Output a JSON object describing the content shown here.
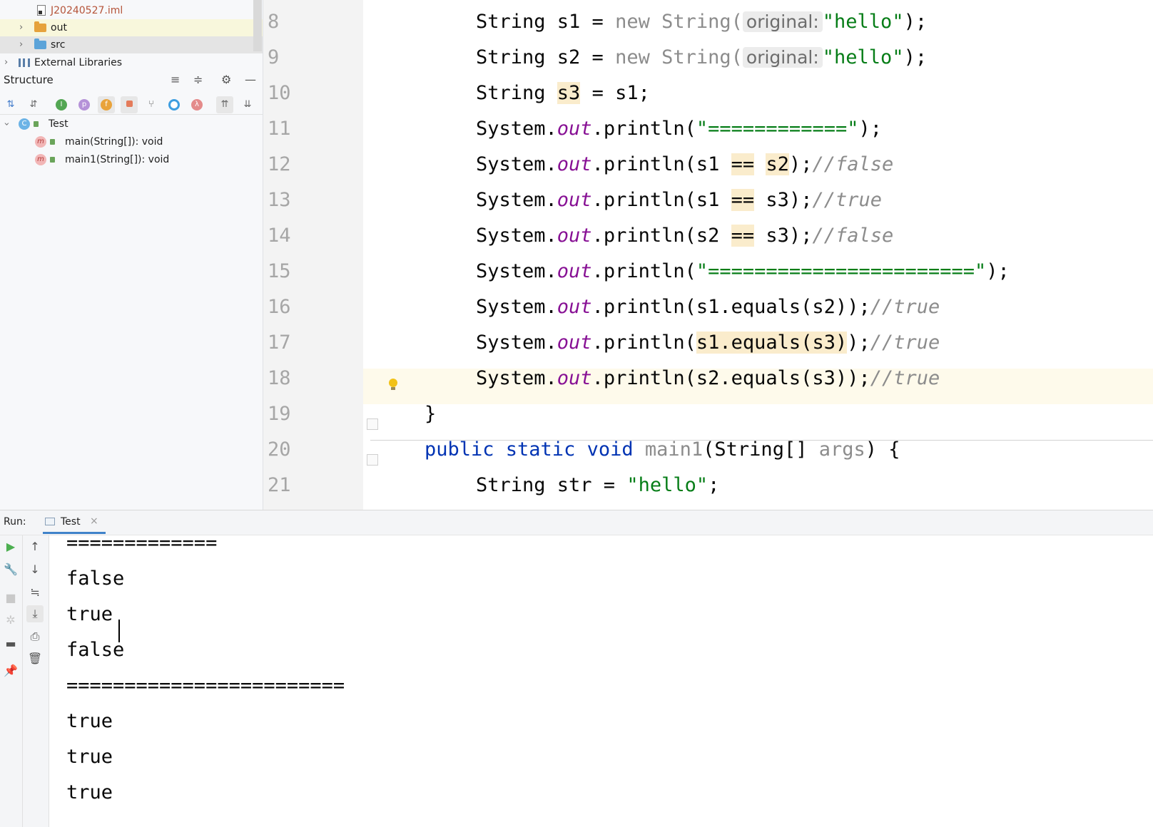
{
  "project_tree": {
    "items": [
      {
        "label": "J20240527.iml",
        "type": "file"
      },
      {
        "label": "out",
        "type": "folder",
        "expanded": false
      },
      {
        "label": "src",
        "type": "folder",
        "expanded": false
      },
      {
        "label": "External Libraries",
        "type": "library",
        "expanded": false
      }
    ]
  },
  "structure": {
    "title": "Structure",
    "tree": [
      {
        "label": "Test",
        "icon": "class-icon"
      },
      {
        "label": "main(String[]): void",
        "icon": "method-icon"
      },
      {
        "label": "main1(String[]): void",
        "icon": "method-icon"
      }
    ]
  },
  "editor": {
    "line_numbers": [
      "8",
      "9",
      "10",
      "11",
      "12",
      "13",
      "14",
      "15",
      "16",
      "17",
      "18",
      "19",
      "20",
      "21"
    ],
    "lines": [
      {
        "t1": "String s1 = ",
        "kw": "new",
        "t2": " String(",
        "hint": "original:",
        "str": "\"hello\"",
        "t3": ");"
      },
      {
        "t1": "String s2 = ",
        "kw": "new",
        "t2": " String(",
        "hint": "original:",
        "str": "\"hello\"",
        "t3": ");"
      },
      {
        "t1": "String ",
        "hl": "s3",
        "t2": " = s1;"
      },
      {
        "t1": "System.",
        "field": "out",
        "t2": ".println(",
        "str": "\"============\"",
        "t3": ");"
      },
      {
        "t1": "System.",
        "field": "out",
        "t2": ".println(s1 ",
        "hl1": "==",
        "t3": " ",
        "hl2": "s2",
        "t4": ");",
        "cmt": "//false"
      },
      {
        "t1": "System.",
        "field": "out",
        "t2": ".println(s1 ",
        "hl1": "==",
        "t3": " s3);",
        "cmt": "//true"
      },
      {
        "t1": "System.",
        "field": "out",
        "t2": ".println(s2 ",
        "hl1": "==",
        "t3": " s3);",
        "cmt": "//false"
      },
      {
        "t1": "System.",
        "field": "out",
        "t2": ".println(",
        "str": "\"=======================\"",
        "t3": ");"
      },
      {
        "t1": "System.",
        "field": "out",
        "t2": ".println(s1.equals(s2));",
        "cmt": "//true"
      },
      {
        "t1": "System.",
        "field": "out",
        "t2": ".println(",
        "hl": "s1.equals(s3)",
        "t3": ");",
        "cmt": "//true"
      },
      {
        "t1": "System.",
        "field": "out",
        "t2": ".println(s2.equals(s3));",
        "cmt": "//true"
      },
      {
        "t1": "}"
      },
      {
        "kw": "public static void",
        "gray": " main1",
        "t1": "(String[] ",
        "gray2": "args",
        "t2": ") {"
      },
      {
        "t1": "String str = ",
        "str": "\"hello\"",
        "t2": ";"
      }
    ]
  },
  "run": {
    "label": "Run:",
    "tab": "Test",
    "close": "×",
    "output": [
      "=============",
      "false",
      "true",
      "false",
      "========================",
      "true",
      "true",
      "true"
    ]
  }
}
